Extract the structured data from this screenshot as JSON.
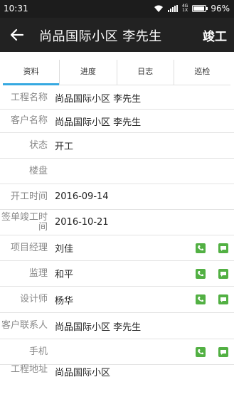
{
  "status_bar": {
    "time": "10:31",
    "network": "4G\n1X",
    "battery": "96%"
  },
  "app_bar": {
    "title": "尚品国际小区 李先生",
    "action": "竣工"
  },
  "tabs": [
    {
      "label": "资料"
    },
    {
      "label": "进度"
    },
    {
      "label": "日志"
    },
    {
      "label": "巡检"
    }
  ],
  "fields": [
    {
      "label": "工程名称",
      "value": "尚品国际小区 李先生"
    },
    {
      "label": "客户名称",
      "value": "尚品国际小区 李先生"
    },
    {
      "label": "状态",
      "value": "开工"
    },
    {
      "label": "楼盘",
      "value": ""
    },
    {
      "label": "开工时间",
      "value": "2016-09-14"
    },
    {
      "label": "签单竣工时间",
      "value": "2016-10-21"
    },
    {
      "label": "项目经理",
      "value": "刘佳"
    },
    {
      "label": "监理",
      "value": "和平"
    },
    {
      "label": "设计师",
      "value": "杨华"
    },
    {
      "label": "客户联系人",
      "value": "尚品国际小区 李先生"
    },
    {
      "label": "手机",
      "value": ""
    },
    {
      "label": "工程地址",
      "value": "尚品国际小区"
    }
  ],
  "colors": {
    "accent": "#36a9e1",
    "icon_green": "#52b043",
    "app_bar": "#222222"
  },
  "icons": {
    "phone": "phone-icon",
    "message": "message-icon",
    "back": "back-arrow-icon"
  }
}
